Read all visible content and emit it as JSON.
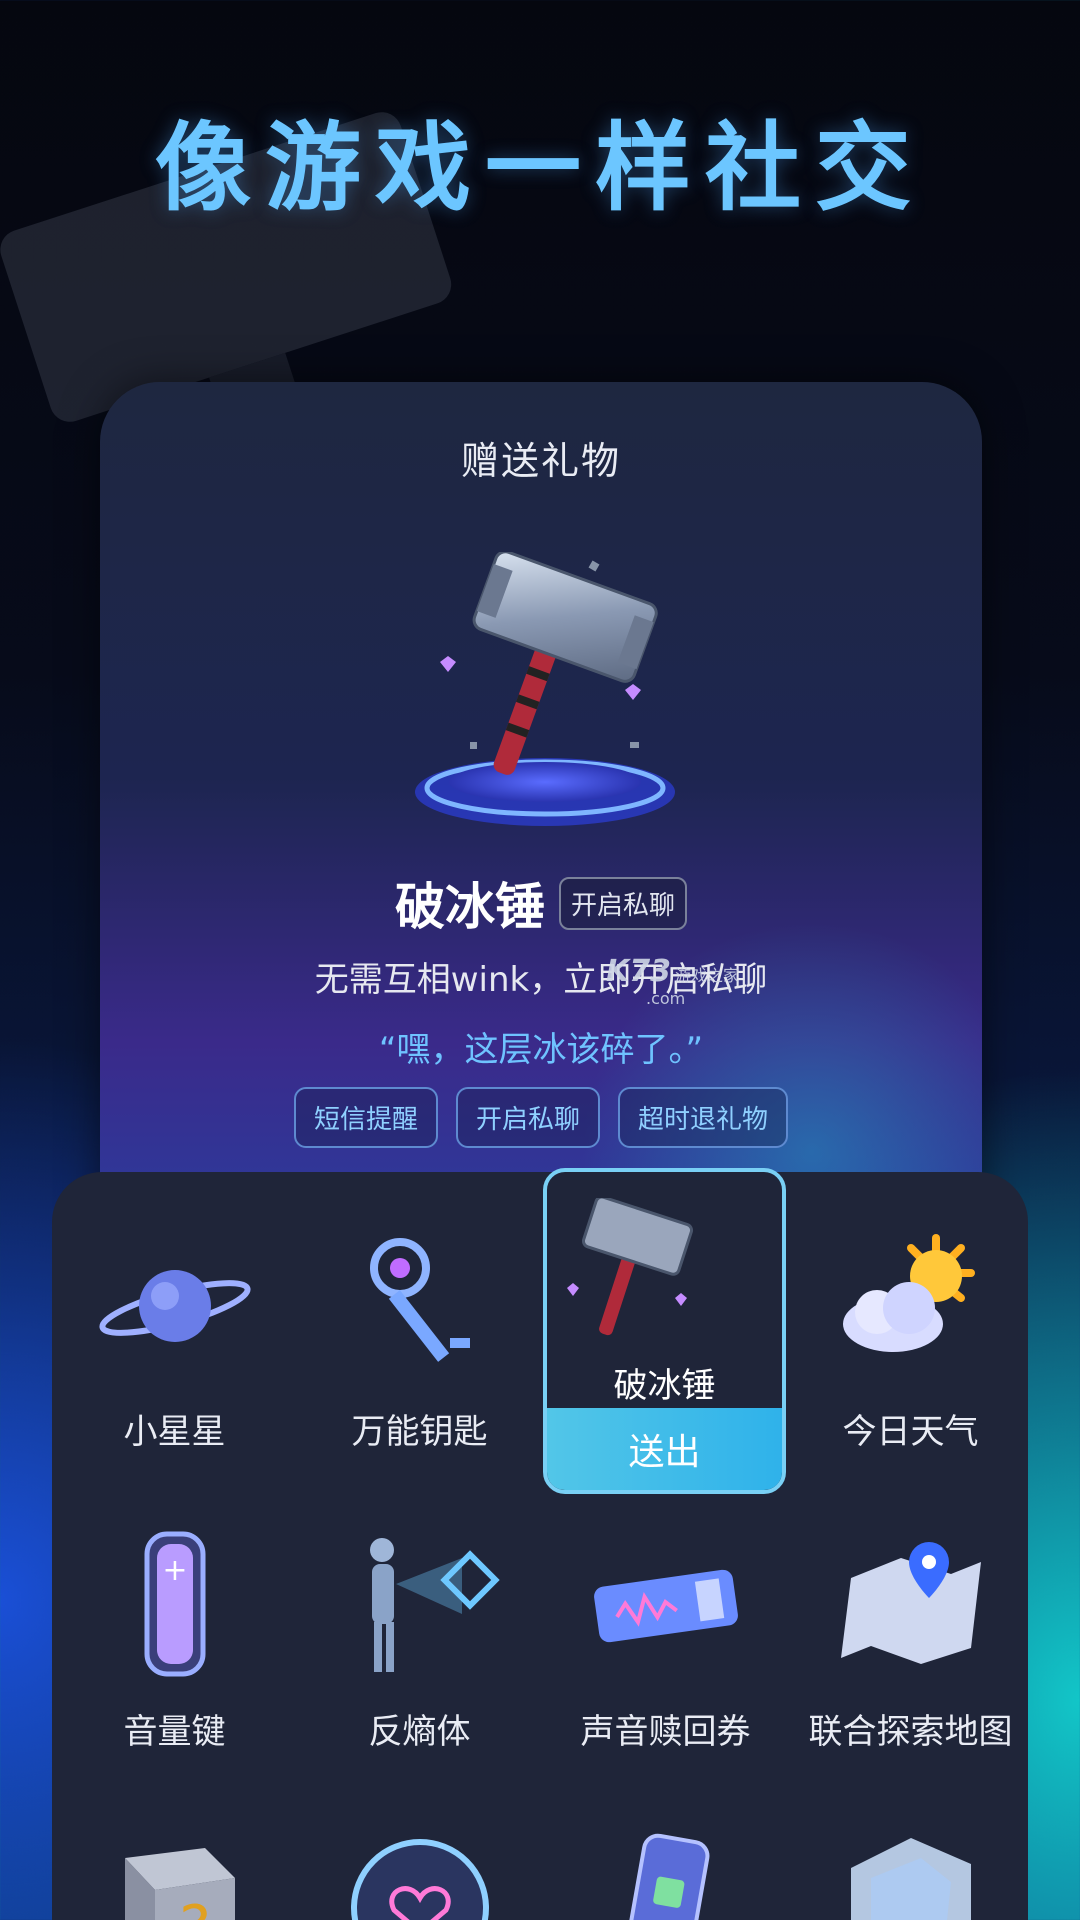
{
  "headline": "像游戏一样社交",
  "preview": {
    "title": "赠送礼物",
    "gift_name": "破冰锤",
    "gift_tag": "开启私聊",
    "description": "无需互相wink，立即开启私聊",
    "quote": "“嘿，这层冰该碎了。”",
    "chips": [
      "短信提醒",
      "开启私聊",
      "超时退礼物"
    ]
  },
  "watermark": {
    "brand": "K73",
    "text": "游戏之家",
    "sub": ".com"
  },
  "gifts_row1": [
    "小星星",
    "万能钥匙",
    "破冰锤",
    "今日天气"
  ],
  "gifts_row2": [
    "音量键",
    "反熵体",
    "声音赎回券",
    "联合探索地图"
  ],
  "selected": {
    "label": "破冰锤",
    "send_label": "送出"
  },
  "icons": {
    "planet": "planet-icon",
    "key": "key-icon",
    "hammer": "hammer-icon",
    "weather": "sun-cloud-icon",
    "volume": "volume-key-icon",
    "figure": "hologram-figure-icon",
    "ticket": "voice-ticket-icon",
    "map": "map-pin-icon",
    "cube": "mystery-cube-icon",
    "gauge": "heart-gauge-icon",
    "phone": "phone-card-icon",
    "ice": "ice-block-icon"
  },
  "colors": {
    "headline": "#6cc6ff",
    "quote": "#6fc3ff",
    "send_button": "#2fb2ea",
    "selected_border": "#79d0f5",
    "panel": "#1f2539"
  }
}
